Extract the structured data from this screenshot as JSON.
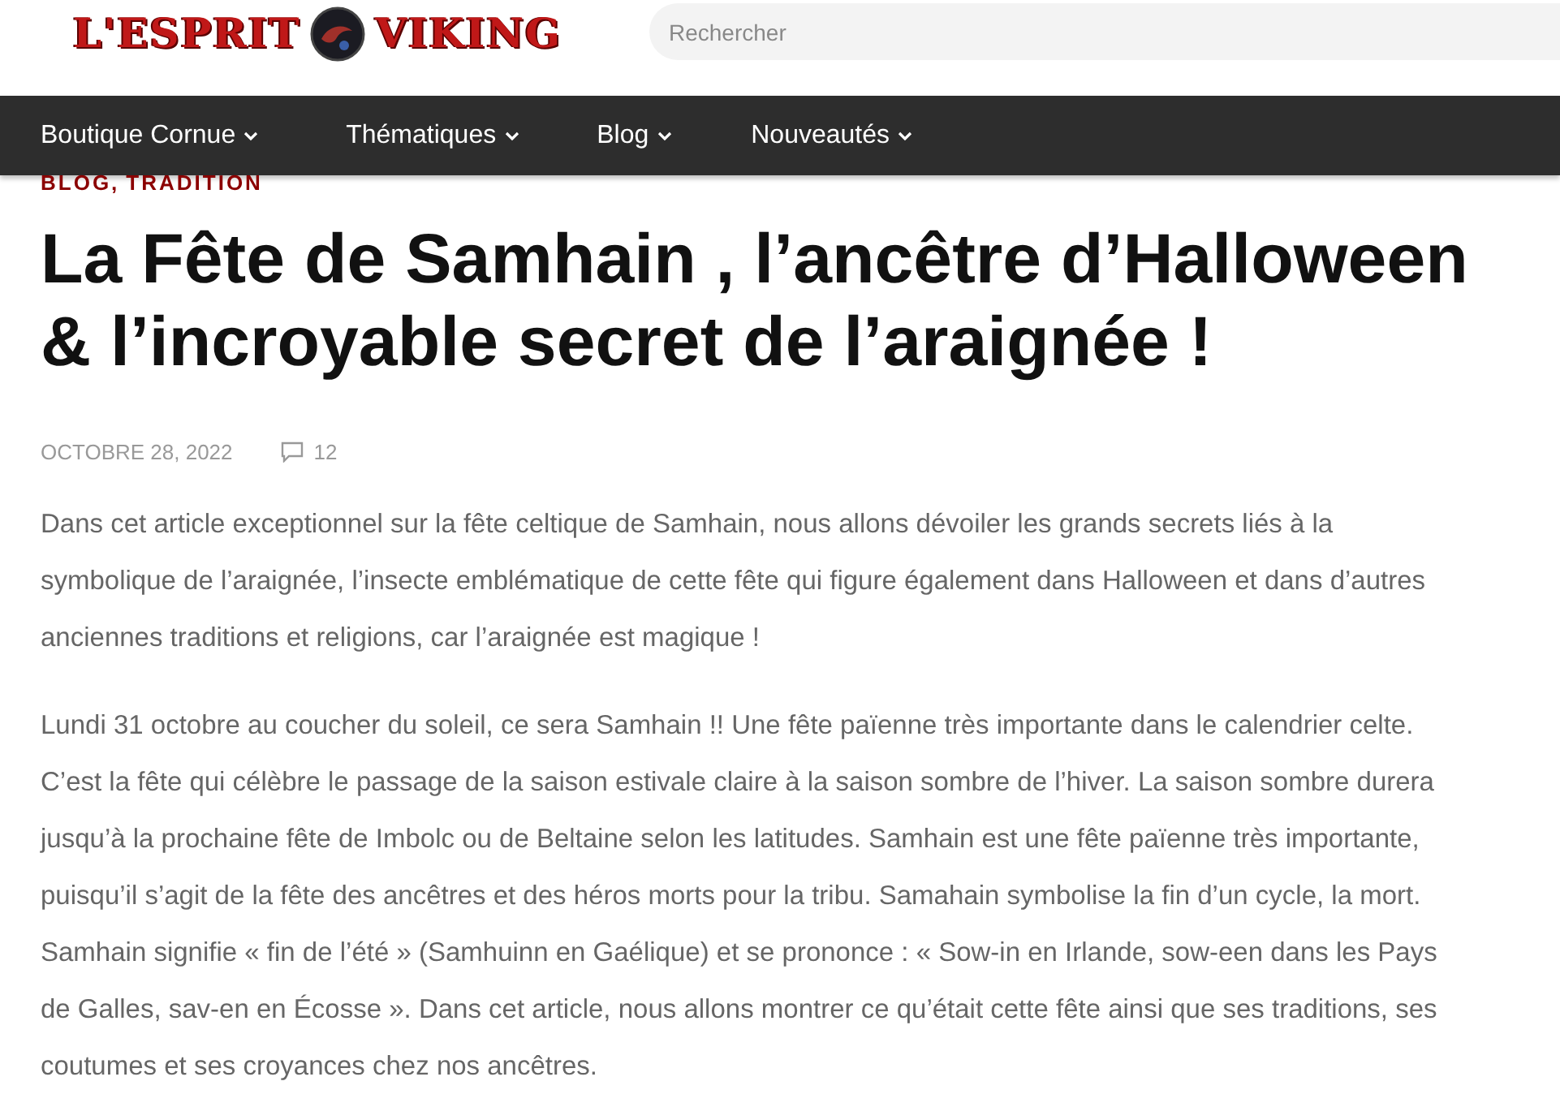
{
  "logo": {
    "left": "L'ESPRIT",
    "right": "VIKING"
  },
  "search": {
    "placeholder": "Rechercher"
  },
  "nav": [
    {
      "label": "Boutique Cornue"
    },
    {
      "label": "Thématiques"
    },
    {
      "label": "Blog"
    },
    {
      "label": "Nouveautés"
    }
  ],
  "article": {
    "categories": [
      "BLOG,",
      "TRADITION"
    ],
    "title_lines": [
      "La Fête de Samhain , l’ancêtre d’Halloween",
      "& l’incroyable secret de l’araignée !"
    ],
    "date": "OCTOBRE 28, 2022",
    "comments": "12",
    "paragraphs": [
      {
        "lines": [
          "Dans cet article exceptionnel sur la fête celtique de Samhain, nous allons dévoiler les grands secrets liés à la",
          "symbolique de l’araignée, l’insecte emblématique de cette fête qui figure également dans Halloween et dans d’autres",
          "anciennes traditions et religions, car l’araignée est magique !"
        ]
      },
      {
        "lines": [
          "Lundi 31 octobre au coucher du soleil, ce sera Samhain !! Une fête païenne très importante dans le calendrier celte.",
          "C’est la fête qui célèbre le passage de la saison estivale claire à la saison sombre de l’hiver. La saison sombre durera",
          "jusqu’à la prochaine fête de Imbolc ou de Beltaine selon les latitudes. Samhain est une fête païenne très importante,",
          "puisqu’il s’agit de la fête des ancêtres et des héros morts pour la tribu. Samahain symbolise la fin d’un cycle, la mort.",
          "Samhain signifie « fin de l’été » (Samhuinn en Gaélique) et se prononce : « Sow-in en Irlande, sow-een dans les Pays",
          "de Galles, sav-en en Écosse ». Dans cet article, nous allons montrer ce qu’était cette fête ainsi que ses traditions, ses",
          "coutumes et ses croyances chez nos ancêtres."
        ]
      }
    ]
  }
}
